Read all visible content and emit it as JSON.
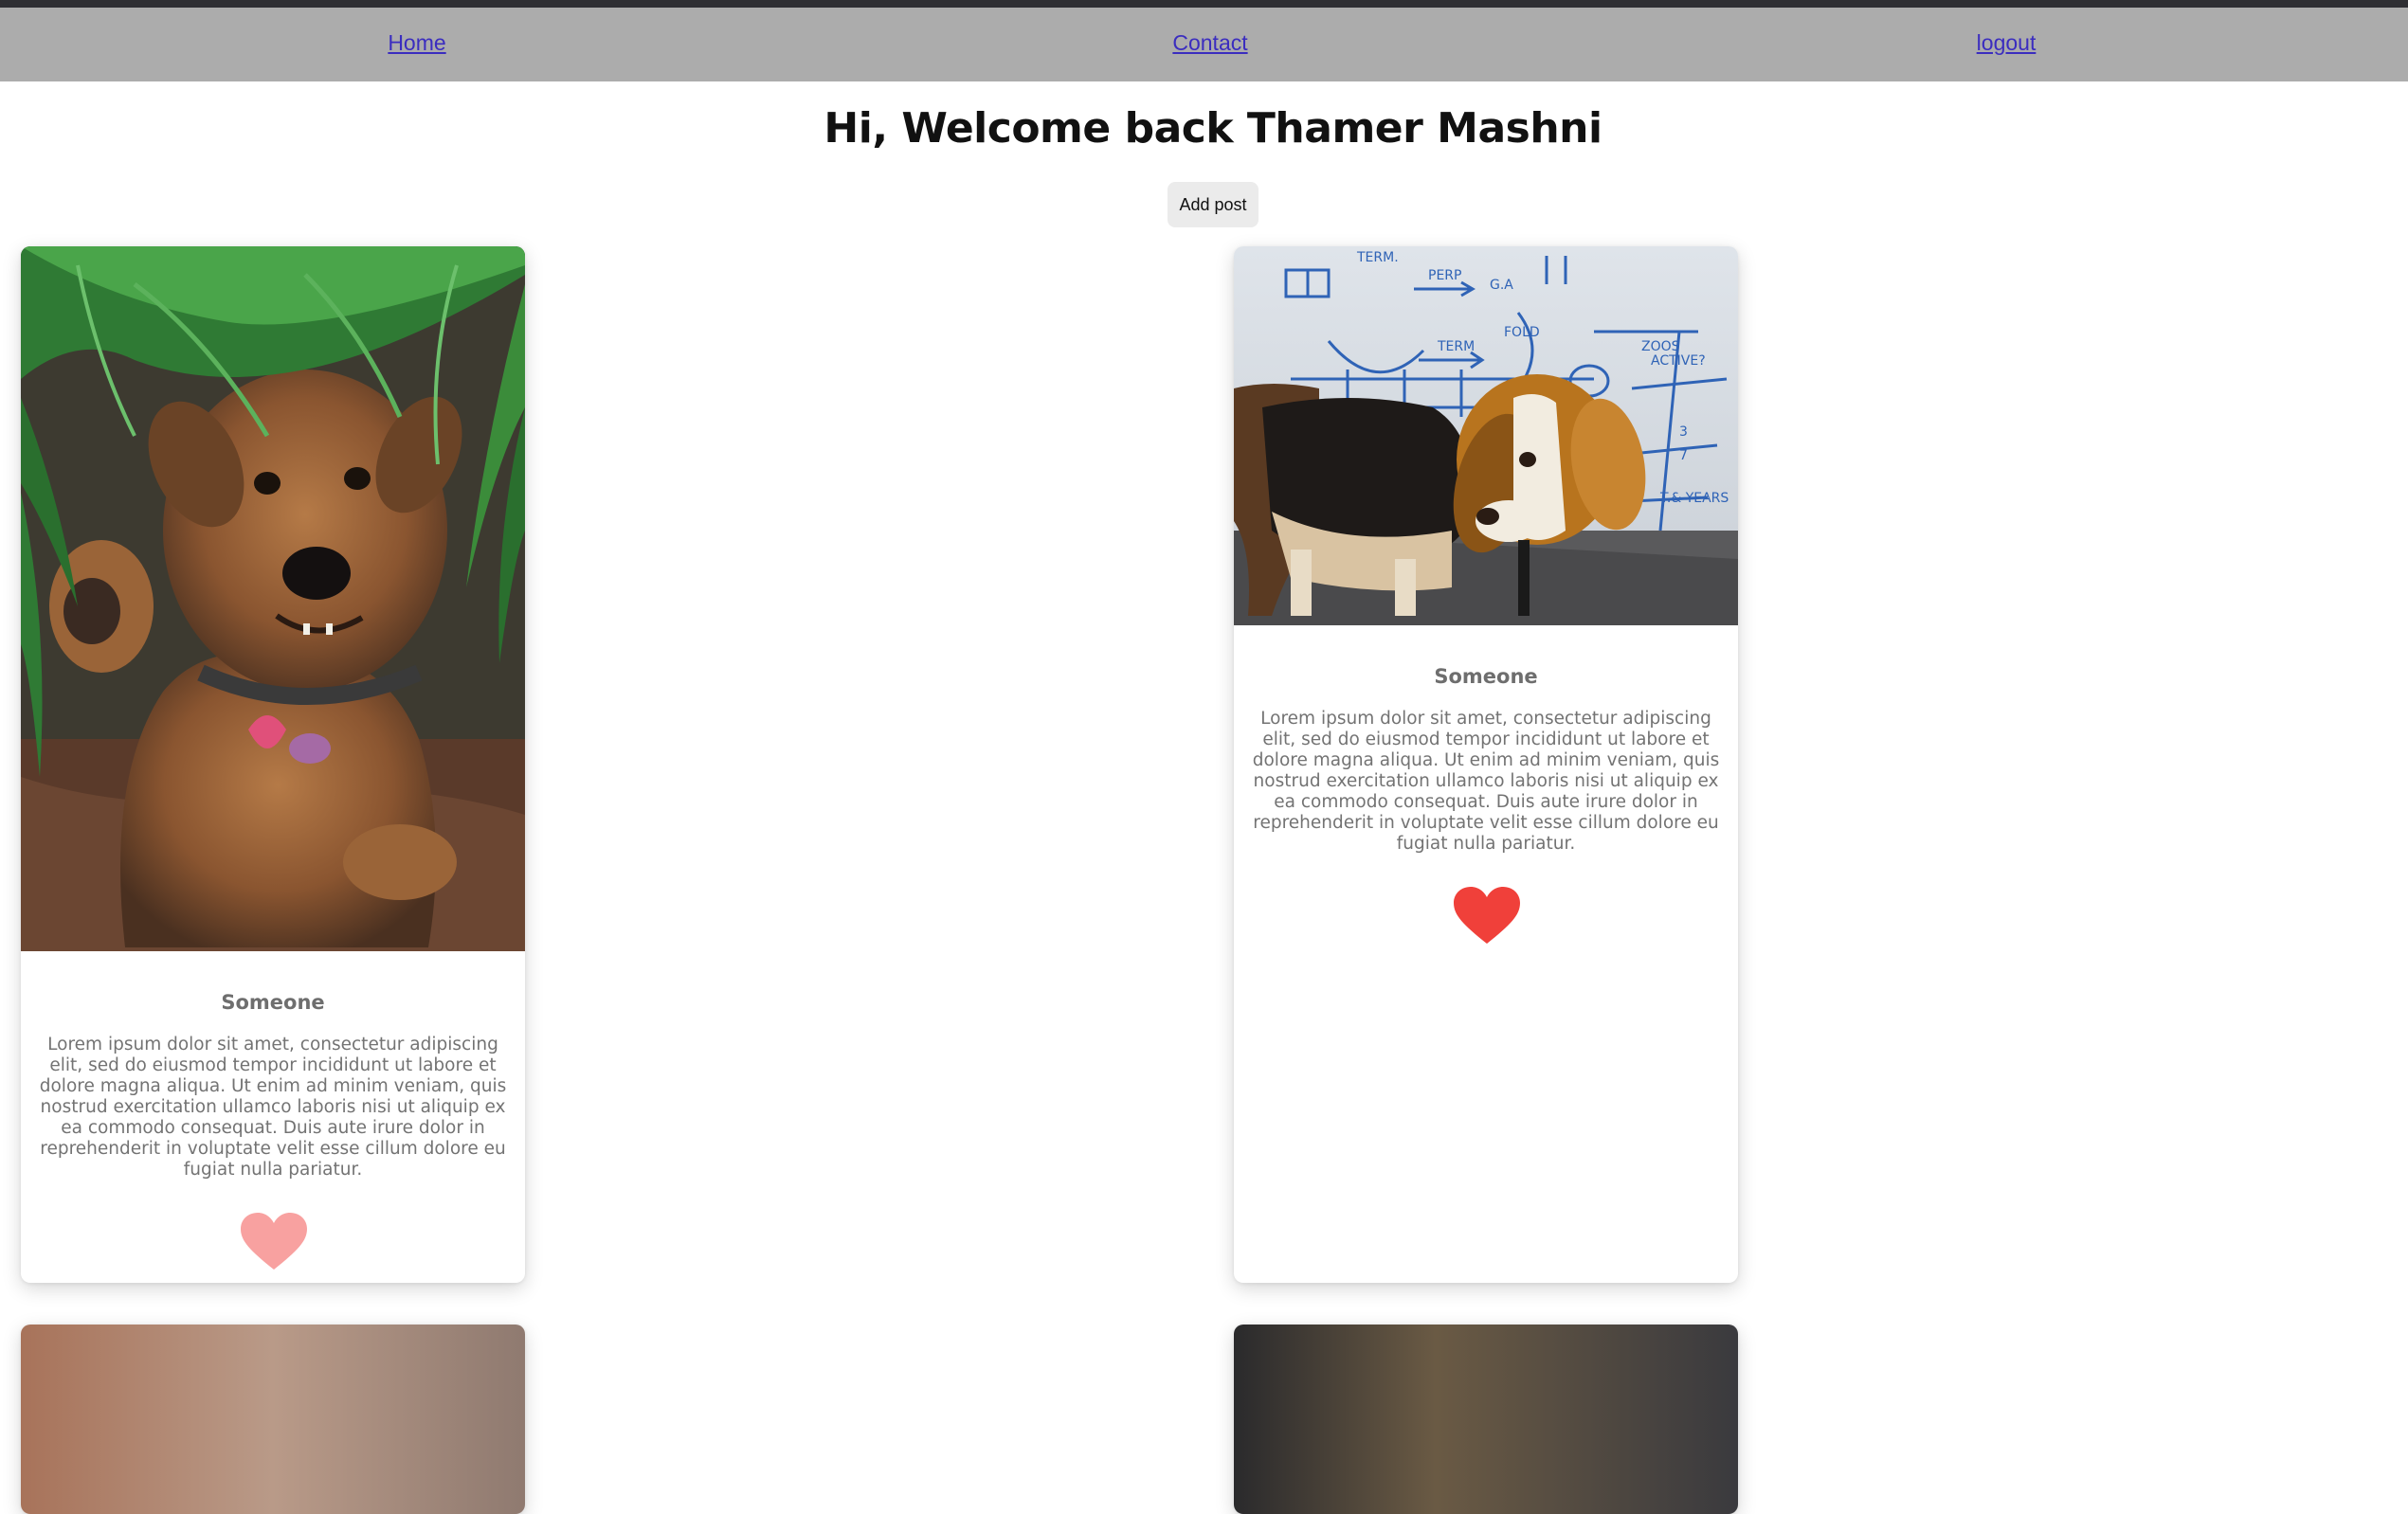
{
  "nav": {
    "home": "Home",
    "contact": "Contact",
    "logout": "logout"
  },
  "header": {
    "greeting": "Hi, Welcome back Thamer Mashni"
  },
  "actions": {
    "add_post": "Add post"
  },
  "posts": [
    {
      "author": "Someone",
      "text": "Lorem ipsum dolor sit amet, consectetur adipiscing elit, sed do eiusmod tempor incididunt ut labore et dolore magna aliqua. Ut enim ad minim veniam, quis nostrud exercitation ullamco laboris nisi ut aliquip ex ea commodo consequat. Duis aute irure dolor in reprehenderit in voluptate velit esse cillum dolore eu fugiat nulla pariatur.",
      "liked": false,
      "heart_color": "#f8a1a0",
      "image": "terrier-under-palm-leaves"
    },
    {
      "author": "Someone",
      "text": "Lorem ipsum dolor sit amet, consectetur adipiscing elit, sed do eiusmod tempor incididunt ut labore et dolore magna aliqua. Ut enim ad minim veniam, quis nostrud exercitation ullamco laboris nisi ut aliquip ex ea commodo consequat. Duis aute irure dolor in reprehenderit in voluptate velit esse cillum dolore eu fugiat nulla pariatur.",
      "liked": true,
      "heart_color": "#f0403a",
      "image": "beagle-at-whiteboard"
    }
  ],
  "colors": {
    "navbar": "#acacac",
    "link": "#3b2dbf",
    "heart_liked": "#f0403a",
    "heart_unliked": "#f8a1a0"
  }
}
